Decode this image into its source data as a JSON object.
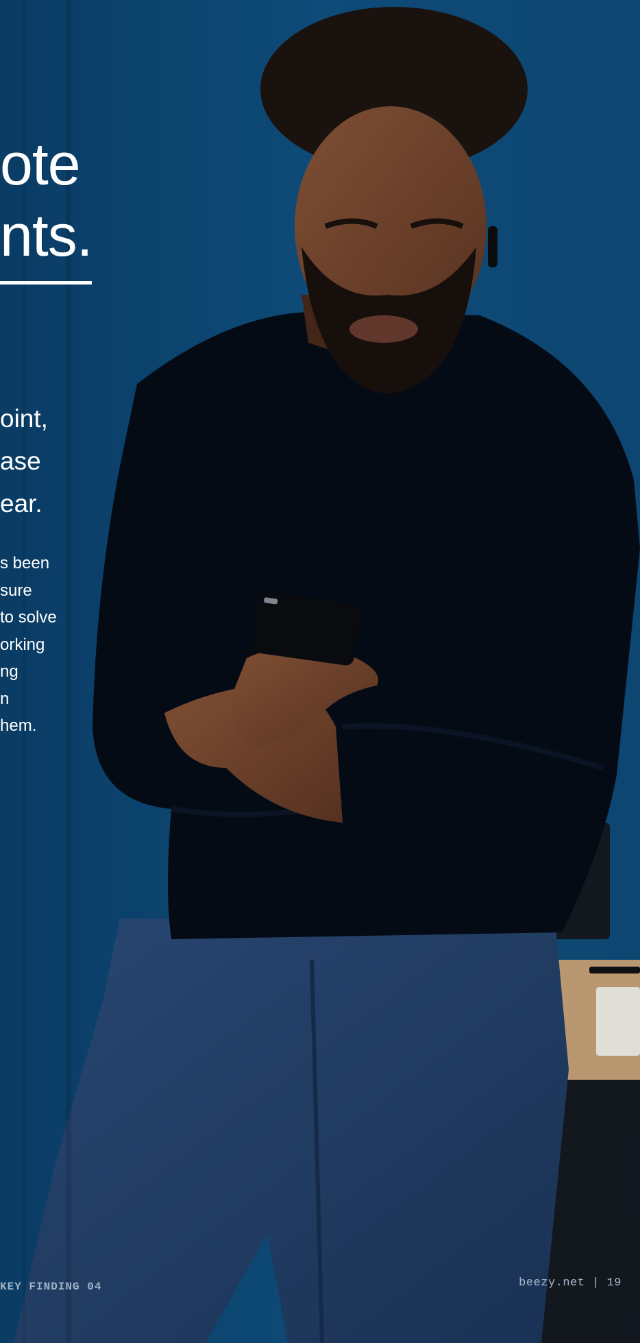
{
  "colors": {
    "background_blue": "#0f4a78",
    "text_white": "#ffffff",
    "footer_text": "#a9bbcd"
  },
  "headline": {
    "line1": "ote",
    "line2": "nts."
  },
  "lead": {
    "line1": "oint,",
    "line2": "ase",
    "line3": "ear."
  },
  "body": {
    "line1": "s been",
    "line2": "sure",
    "line3": "to solve",
    "line4": "orking",
    "line5": "ng",
    "line6": "n",
    "line7": "hem."
  },
  "footer": {
    "section": "KEY FINDING 04",
    "site_page": "beezy.net | 19"
  }
}
